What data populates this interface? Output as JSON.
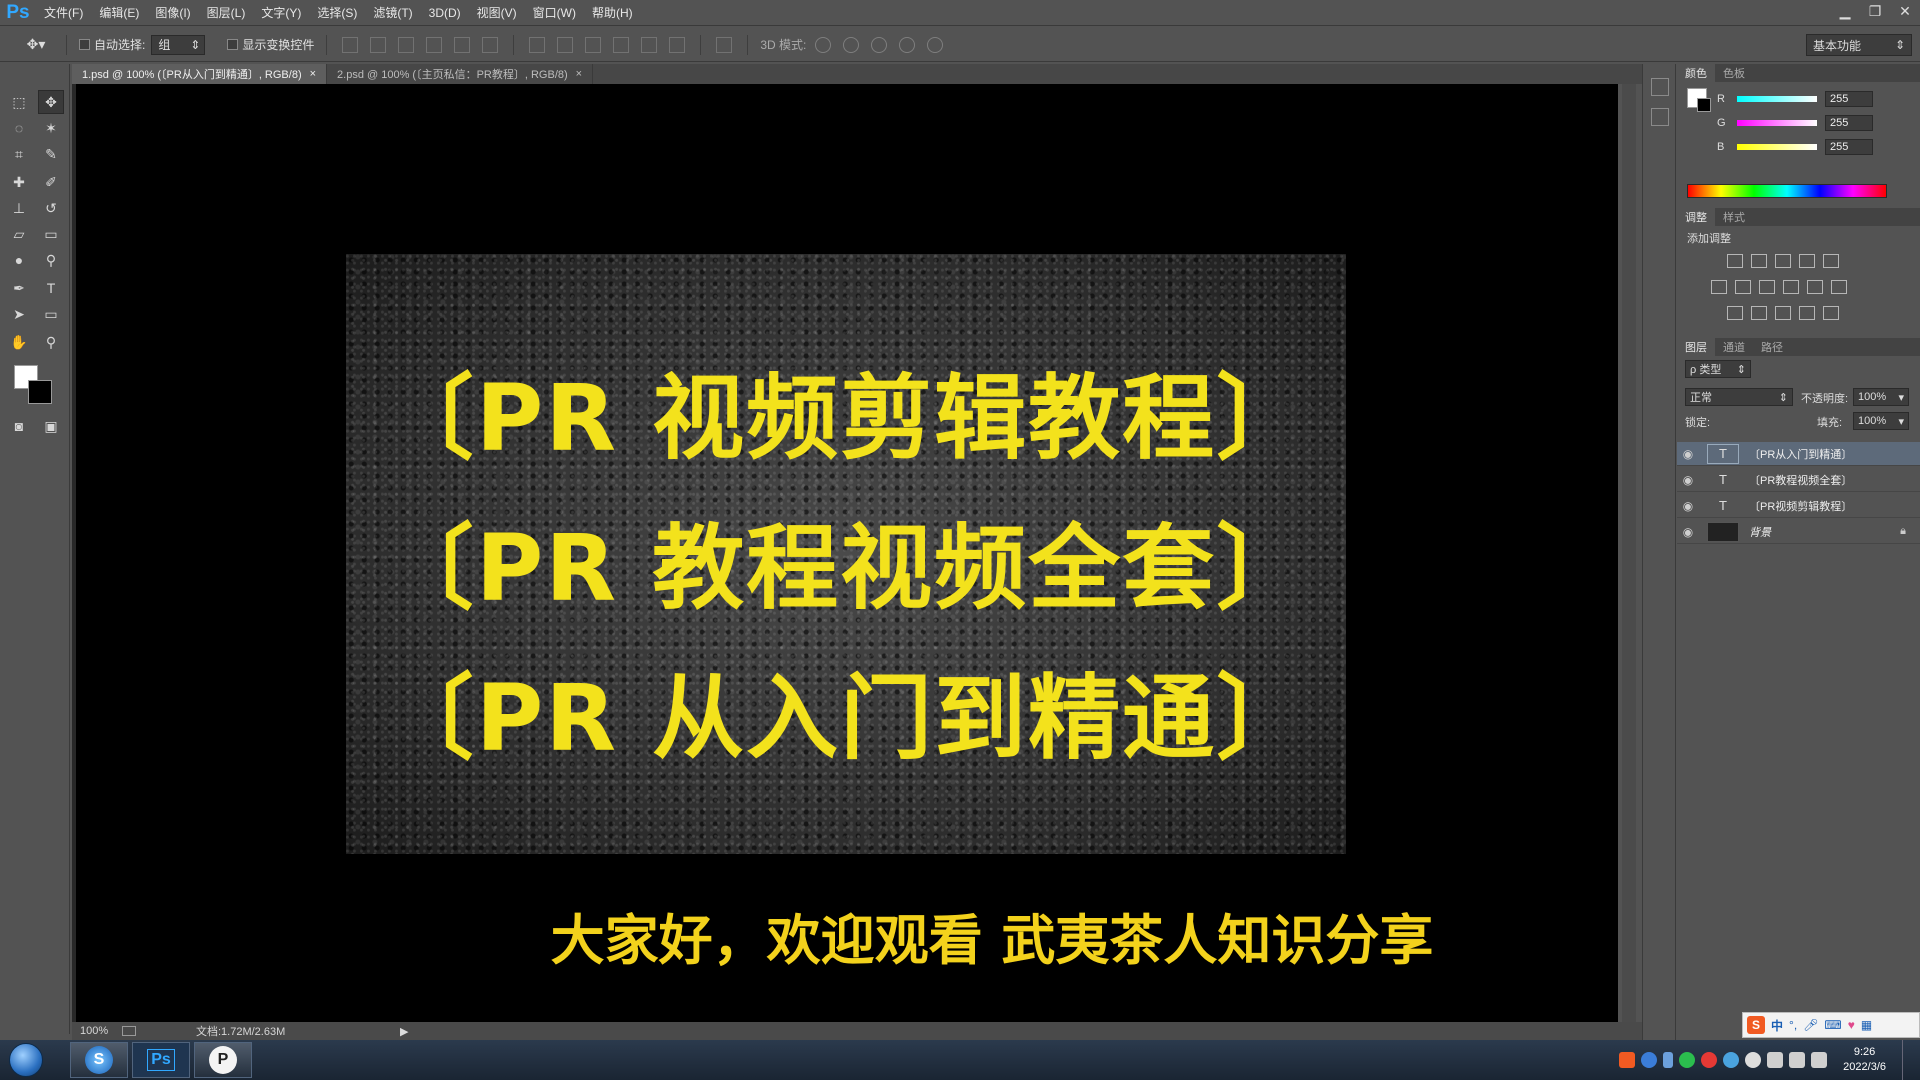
{
  "app": {
    "logo": "Ps"
  },
  "menu": [
    "文件(F)",
    "编辑(E)",
    "图像(I)",
    "图层(L)",
    "文字(Y)",
    "选择(S)",
    "滤镜(T)",
    "3D(D)",
    "视图(V)",
    "窗口(W)",
    "帮助(H)"
  ],
  "options": {
    "auto_select_label": "自动选择:",
    "auto_select_value": "组",
    "show_transform_label": "显示变换控件",
    "mode3d_label": "3D 模式:",
    "workspace": "基本功能"
  },
  "tabs": [
    {
      "label": "1.psd @ 100% (〔PR从入门到精通〕, RGB/8)",
      "close": "×"
    },
    {
      "label": "2.psd @ 100% (〔主页私信：PR教程〕, RGB/8)",
      "close": "×"
    }
  ],
  "canvas": {
    "lines": [
      "〔PR 视频剪辑教程〕",
      "〔PR 教程视频全套〕",
      "〔PR 从入门到精通〕"
    ],
    "subtitle": "大家好，欢迎观看 武夷茶人知识分享"
  },
  "status": {
    "zoom": "100%",
    "doc": "文档:1.72M/2.63M"
  },
  "color_panel": {
    "tabs": [
      "颜色",
      "色板"
    ],
    "channels": [
      {
        "name": "R",
        "value": "255"
      },
      {
        "name": "G",
        "value": "255"
      },
      {
        "name": "B",
        "value": "255"
      }
    ]
  },
  "adjust_panel": {
    "tabs": [
      "调整",
      "样式"
    ],
    "title": "添加调整"
  },
  "layers_panel": {
    "tabs": [
      "图层",
      "通道",
      "路径"
    ],
    "filter": "ρ 类型",
    "blend": "正常",
    "opacity_label": "不透明度:",
    "opacity": "100%",
    "lock_label": "锁定:",
    "fill_label": "填充:",
    "fill": "100%",
    "layers": [
      {
        "type": "T",
        "name": "〔PR从入门到精通〕",
        "selected": true
      },
      {
        "type": "T",
        "name": "〔PR教程视频全套〕",
        "selected": false
      },
      {
        "type": "T",
        "name": "〔PR视频剪辑教程〕",
        "selected": false
      },
      {
        "type": "img",
        "name": "背景",
        "selected": false
      }
    ]
  },
  "taskbar": {
    "apps": [
      "S",
      "Ps",
      "P"
    ],
    "ime_labels": [
      "中",
      "°,"
    ],
    "time": "9:26",
    "date": "2022/3/6"
  },
  "colors": {
    "accent_text": "#f3e21c",
    "subtitle_text": "#f3d21c",
    "ps_blue": "#31a8ff"
  }
}
